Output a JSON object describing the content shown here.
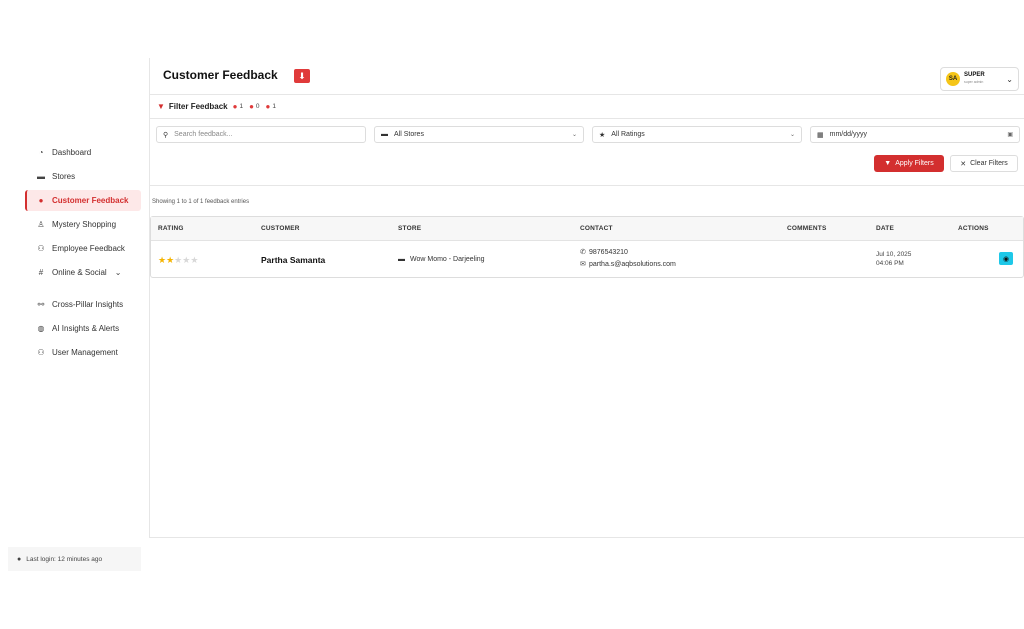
{
  "sidebar": {
    "items": [
      {
        "label": "Dashboard",
        "icon": "dashboard-icon"
      },
      {
        "label": "Stores",
        "icon": "store-icon"
      },
      {
        "label": "Customer Feedback",
        "icon": "comments-icon",
        "active": true
      },
      {
        "label": "Mystery Shopping",
        "icon": "user-secret-icon"
      },
      {
        "label": "Employee Feedback",
        "icon": "users-icon"
      },
      {
        "label": "Online & Social",
        "icon": "hashtag-icon"
      },
      {
        "label": "Cross-Pillar Insights",
        "icon": "network-icon"
      },
      {
        "label": "AI Insights & Alerts",
        "icon": "brain-icon"
      },
      {
        "label": "User Management",
        "icon": "users-cog-icon"
      }
    ],
    "last_login": "Last login: 12 minutes ago"
  },
  "header": {
    "title": "Customer Feedback",
    "user": {
      "initials": "SA",
      "name": "SUPER",
      "role": "super admin"
    }
  },
  "filters": {
    "title": "Filter Feedback",
    "badges": [
      "1",
      "0",
      "1"
    ],
    "search_placeholder": "Search feedback...",
    "store_selected": "All Stores",
    "rating_selected": "All Ratings",
    "date_placeholder": "mm/dd/yyyy",
    "apply_label": "Apply Filters",
    "clear_label": "Clear Filters"
  },
  "showing_text": "Showing 1 to 1 of 1 feedback entries",
  "table": {
    "columns": [
      "RATING",
      "CUSTOMER",
      "STORE",
      "CONTACT",
      "COMMENTS",
      "DATE",
      "ACTIONS"
    ],
    "rows": [
      {
        "rating": 2,
        "customer": "Partha Samanta",
        "store": "Wow Momo - Darjeeling",
        "phone": "9876543210",
        "email": "partha.s@aqbsolutions.com",
        "comments": "",
        "date": "Jul 10, 2025",
        "time": "04:06 PM"
      }
    ]
  },
  "colors": {
    "accent": "#d32f2f",
    "view_button": "#1ec8e8",
    "star": "#f5b400"
  }
}
